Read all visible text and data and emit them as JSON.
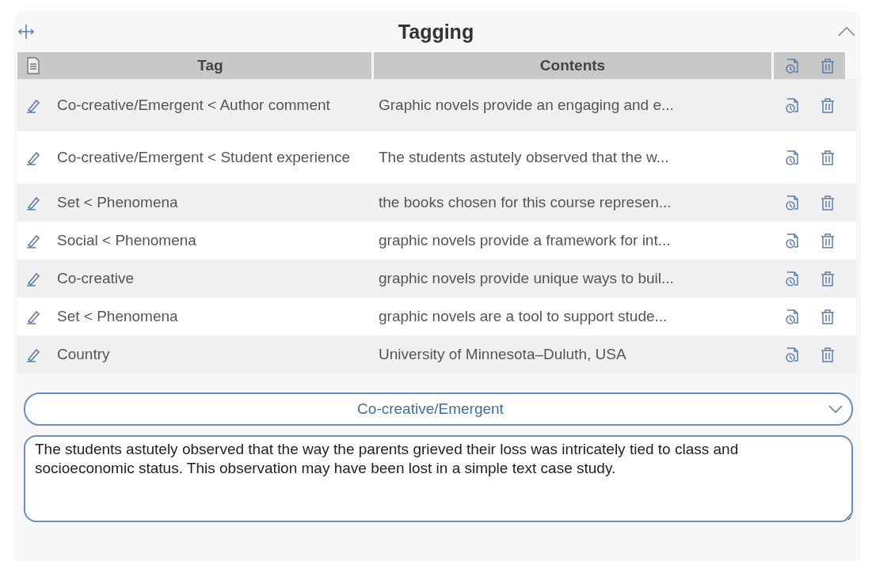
{
  "panel": {
    "title": "Tagging"
  },
  "table": {
    "columns": [
      "Tag",
      "Contents"
    ],
    "rows": [
      {
        "tag": "Co-creative/Emergent < Author comment",
        "contents": "Graphic novels provide an engaging and e..."
      },
      {
        "tag": "Co-creative/Emergent < Student experience",
        "contents": "The students astutely observed that the w..."
      },
      {
        "tag": "Set < Phenomena",
        "contents": "the books chosen for this course represen..."
      },
      {
        "tag": "Social < Phenomena",
        "contents": "graphic novels provide a framework for int..."
      },
      {
        "tag": "Co-creative",
        "contents": "graphic novels provide unique ways to buil..."
      },
      {
        "tag": "Set < Phenomena",
        "contents": "graphic novels are a tool to support stude..."
      },
      {
        "tag": "Country",
        "contents": "University of Minnesota–Duluth, USA"
      }
    ]
  },
  "tag_select": {
    "value": "Co-creative/Emergent"
  },
  "text_field": {
    "value": "The students astutely observed that the way the parents grieved their loss was intricately tied to class and socioeconomic status. This observation may have been lost in a simple text case study."
  }
}
